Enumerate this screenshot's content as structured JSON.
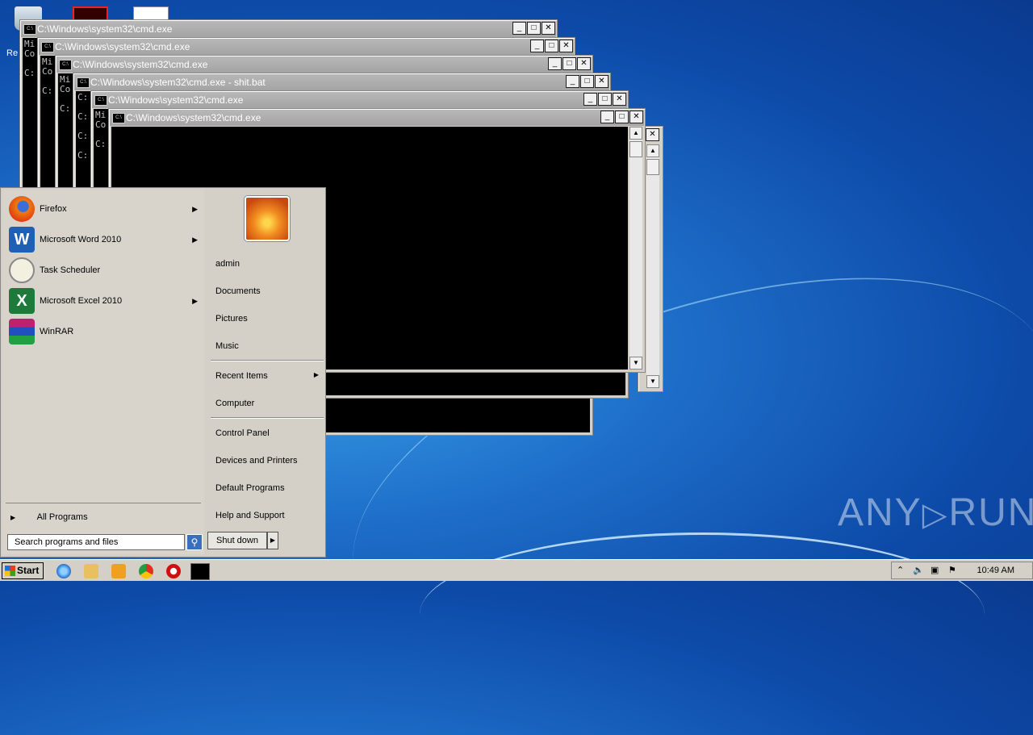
{
  "desktop": {
    "recycle_label": "Re",
    "watermark": "ANY RUN",
    "watermark_left": "ANY",
    "watermark_right": "RUN"
  },
  "windows": [
    {
      "title": "C:\\Windows\\system32\\cmd.exe",
      "lines": [
        "Mi",
        "Co",
        "",
        "C:"
      ]
    },
    {
      "title": "C:\\Windows\\system32\\cmd.exe",
      "lines": [
        "Mi",
        "Co",
        "",
        "C:"
      ]
    },
    {
      "title": "C:\\Windows\\system32\\cmd.exe",
      "lines": [
        "Mi",
        "Co",
        "",
        "C:"
      ]
    },
    {
      "title": "C:\\Windows\\system32\\cmd.exe - shit.bat",
      "lines": [
        "C:",
        "",
        "C:",
        "",
        "C:",
        "",
        "C:"
      ]
    },
    {
      "title": "C:\\Windows\\system32\\cmd.exe",
      "lines": [
        "Mi",
        "Co",
        "",
        "C:"
      ]
    },
    {
      "title": "C:\\Windows\\system32\\cmd.exe",
      "lines": []
    }
  ],
  "window_buttons": {
    "min": "_",
    "max": "□",
    "close": "✕"
  },
  "start_menu": {
    "programs": [
      {
        "label": "Firefox",
        "icon": "firefox-icon",
        "has_submenu": true
      },
      {
        "label": "Microsoft Word 2010",
        "icon": "word-icon",
        "has_submenu": true
      },
      {
        "label": "Task Scheduler",
        "icon": "task-scheduler-icon",
        "has_submenu": false
      },
      {
        "label": "Microsoft Excel 2010",
        "icon": "excel-icon",
        "has_submenu": true
      },
      {
        "label": "WinRAR",
        "icon": "winrar-icon",
        "has_submenu": false
      }
    ],
    "all_programs": "All Programs",
    "search_placeholder": "Search programs and files",
    "right_items": {
      "user": "admin",
      "documents": "Documents",
      "pictures": "Pictures",
      "music": "Music",
      "recent_items": "Recent Items",
      "computer": "Computer",
      "control_panel": "Control Panel",
      "devices_printers": "Devices and Printers",
      "default_programs": "Default Programs",
      "help_support": "Help and Support"
    },
    "shutdown_label": "Shut down"
  },
  "taskbar": {
    "start_label": "Start",
    "clock": "10:49 AM"
  },
  "colors": {
    "desktop_blue": "#1e6fc9",
    "title_inactive": "#a8a8a8",
    "console_bg": "#000000"
  }
}
